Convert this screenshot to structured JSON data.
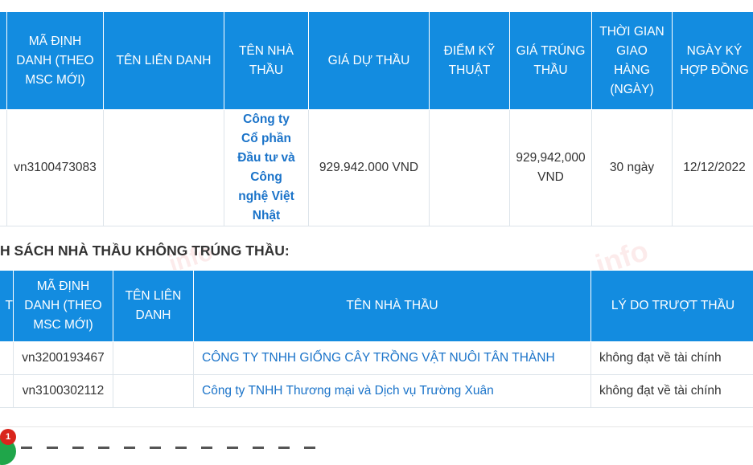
{
  "winners": {
    "headers": [
      "",
      "MÃ ĐỊNH DANH (THEO MSC MỚI)",
      "TÊN LIÊN DANH",
      "TÊN NHÀ THẦU",
      "GIÁ DỰ THẦU",
      "ĐIỂM KỸ THUẬT",
      "GIÁ TRÚNG THẦU",
      "THỜI GIAN GIAO HÀNG (NGÀY)",
      "NGÀY KÝ HỢP ĐỒNG"
    ],
    "row": {
      "stt": "",
      "code": "vn3100473083",
      "joint_name": "",
      "contractor": "Công ty Cổ phần Đầu tư và Công nghệ Việt Nhật",
      "bid_price": "929.942.000 VND",
      "tech_score": "",
      "win_price": "929,942,000 VND",
      "delivery": "30 ngày",
      "sign_date": "12/12/2022"
    }
  },
  "losers": {
    "title": "H SÁCH NHÀ THẦU KHÔNG TRÚNG THẦU:",
    "headers": [
      "T",
      "MÃ ĐỊNH DANH (THEO MSC MỚI)",
      "TÊN LIÊN DANH",
      "TÊN NHÀ THẦU",
      "LÝ DO TRƯỢT THẦU"
    ],
    "rows": [
      {
        "code": "vn3200193467",
        "joint_name": "",
        "contractor": "CÔNG TY TNHH GIỐNG CÂY TRỒNG VẬT NUÔI TÂN THÀNH",
        "reason": "không đạt về tài chính"
      },
      {
        "code": "vn3100302112",
        "joint_name": "",
        "contractor": "Công ty TNHH Thương mại và Dịch vụ Trường Xuân",
        "reason": "không đạt về tài chính"
      }
    ]
  },
  "watermark": {
    "text": "info"
  },
  "chat": {
    "badge_count": "1",
    "icon": "chat-icon"
  }
}
